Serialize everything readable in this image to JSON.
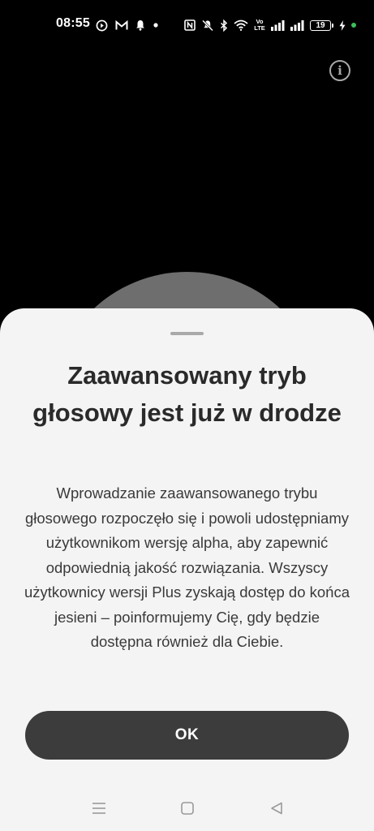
{
  "status_bar": {
    "time": "08:55",
    "battery_level": "19",
    "left_icons": [
      "play-circle-icon",
      "mail-icon",
      "bell-icon",
      "dot-icon"
    ],
    "right_icons": [
      "nfc-icon",
      "mute-icon",
      "bluetooth-icon",
      "wifi-icon",
      "volte-icon",
      "signal-icon",
      "signal-icon",
      "battery-icon",
      "charging-icon",
      "green-dot-icon"
    ],
    "volte_label": "Vo LTE"
  },
  "info": {
    "icon": "info-icon",
    "glyph": "i"
  },
  "sheet": {
    "title": "Zaawansowany tryb głosowy jest już w drodze",
    "body": "Wprowadzanie zaawansowanego trybu głosowego rozpoczęło się i powoli udostępniamy użytkownikom wersję alpha, aby zapewnić odpowiednią jakość rozwiązania. Wszyscy użytkownicy wersji Plus zyskają dostęp do końca jesieni – poinformujemy Cię, gdy będzie dostępna również dla Ciebie.",
    "ok_label": "OK"
  },
  "colors": {
    "background": "#000000",
    "sheet": "#f4f4f4",
    "orb": "#6e6e6e",
    "button": "#3c3c3c",
    "title_text": "#2a2a2a",
    "body_text": "#3a3a3a"
  },
  "nav_bar": {
    "items": [
      "menu-icon",
      "home-icon",
      "back-icon"
    ]
  }
}
